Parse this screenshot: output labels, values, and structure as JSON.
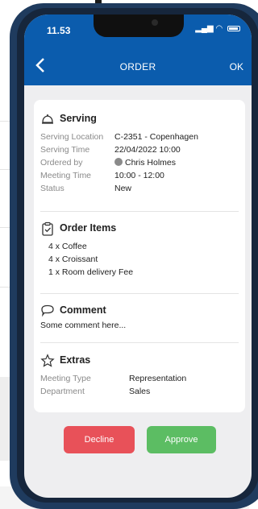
{
  "statusbar": {
    "time": "11.53"
  },
  "navbar": {
    "back_icon": "chevron-left-icon",
    "title": "ORDER",
    "ok_label": "OK"
  },
  "serving": {
    "title": "Serving",
    "icon": "bell-icon",
    "fields": [
      {
        "label": "Serving Location",
        "value": "C-2351 - Copenhagen"
      },
      {
        "label": "Serving Time",
        "value": "22/04/2022 10:00"
      },
      {
        "label": "Ordered by",
        "value": "Chris Holmes"
      },
      {
        "label": "Meeting Time",
        "value": "10:00 - 12:00"
      },
      {
        "label": "Status",
        "value": "New"
      }
    ]
  },
  "order_items": {
    "title": "Order Items",
    "icon": "clipboard-check-icon",
    "items": [
      "4 x Coffee",
      "4 x Croissant",
      "1 x Room delivery Fee"
    ]
  },
  "comment": {
    "title": "Comment",
    "icon": "speech-bubble-icon",
    "text": "Some comment here..."
  },
  "extras": {
    "title": "Extras",
    "icon": "star-icon",
    "fields": [
      {
        "label": "Meeting Type",
        "value": "Representation"
      },
      {
        "label": "Department",
        "value": "Sales"
      }
    ]
  },
  "actions": {
    "decline_label": "Decline",
    "approve_label": "Approve"
  },
  "colors": {
    "header": "#0b5cad",
    "decline": "#e85159",
    "approve": "#5cbd63"
  }
}
